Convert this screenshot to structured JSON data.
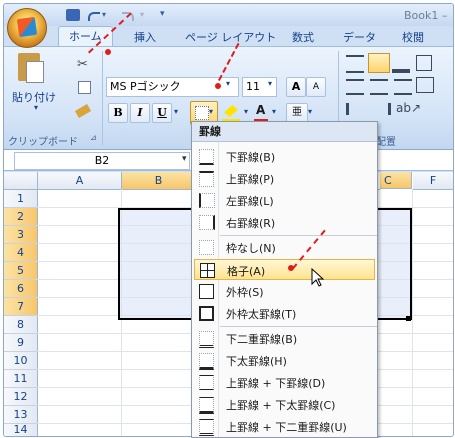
{
  "titlebar": {
    "title": "Book1 –"
  },
  "tabs": [
    {
      "label": "ホーム"
    },
    {
      "label": "挿入"
    },
    {
      "label": "ページ レイアウト"
    },
    {
      "label": "数式"
    },
    {
      "label": "データ"
    },
    {
      "label": "校閲"
    }
  ],
  "ribbon": {
    "paste_label": "貼り付け",
    "clipboard_group": "クリップボード",
    "font_name": "MS Pゴシック",
    "font_size": "11",
    "bold": "B",
    "italic": "I",
    "underline": "U",
    "grow_font": "A",
    "shrink_font": "A",
    "align_group": "配置"
  },
  "namebox": {
    "value": "B2"
  },
  "columns": [
    "A",
    "B",
    "C",
    "F"
  ],
  "rows": [
    "1",
    "2",
    "3",
    "4",
    "5",
    "6",
    "7",
    "8",
    "9",
    "10",
    "11",
    "12",
    "13",
    "14"
  ],
  "menu": {
    "header": "罫線",
    "items": [
      {
        "label": "下罫線(B)",
        "icon": "border-bottom-icon"
      },
      {
        "label": "上罫線(P)",
        "icon": "border-top-icon"
      },
      {
        "label": "左罫線(L)",
        "icon": "border-left-icon"
      },
      {
        "label": "右罫線(R)",
        "icon": "border-right-icon"
      },
      {
        "label": "枠なし(N)",
        "icon": "no-border-icon"
      },
      {
        "label": "格子(A)",
        "icon": "all-borders-icon"
      },
      {
        "label": "外枠(S)",
        "icon": "outside-borders-icon"
      },
      {
        "label": "外枠太罫線(T)",
        "icon": "thick-box-border-icon"
      },
      {
        "label": "下二重罫線(B)",
        "icon": "bottom-double-border-icon"
      },
      {
        "label": "下太罫線(H)",
        "icon": "thick-bottom-border-icon"
      },
      {
        "label": "上罫線 + 下罫線(D)",
        "icon": "top-bottom-border-icon"
      },
      {
        "label": "上罫線 + 下太罫線(C)",
        "icon": "top-thick-bottom-border-icon"
      },
      {
        "label": "上罫線 + 下二重罫線(U)",
        "icon": "top-double-bottom-border-icon"
      }
    ],
    "highlighted_index": 5
  },
  "colors": {
    "accent": "#e01d1d",
    "highlight": "#ffe38f",
    "selected_header": "#f7c66a"
  }
}
